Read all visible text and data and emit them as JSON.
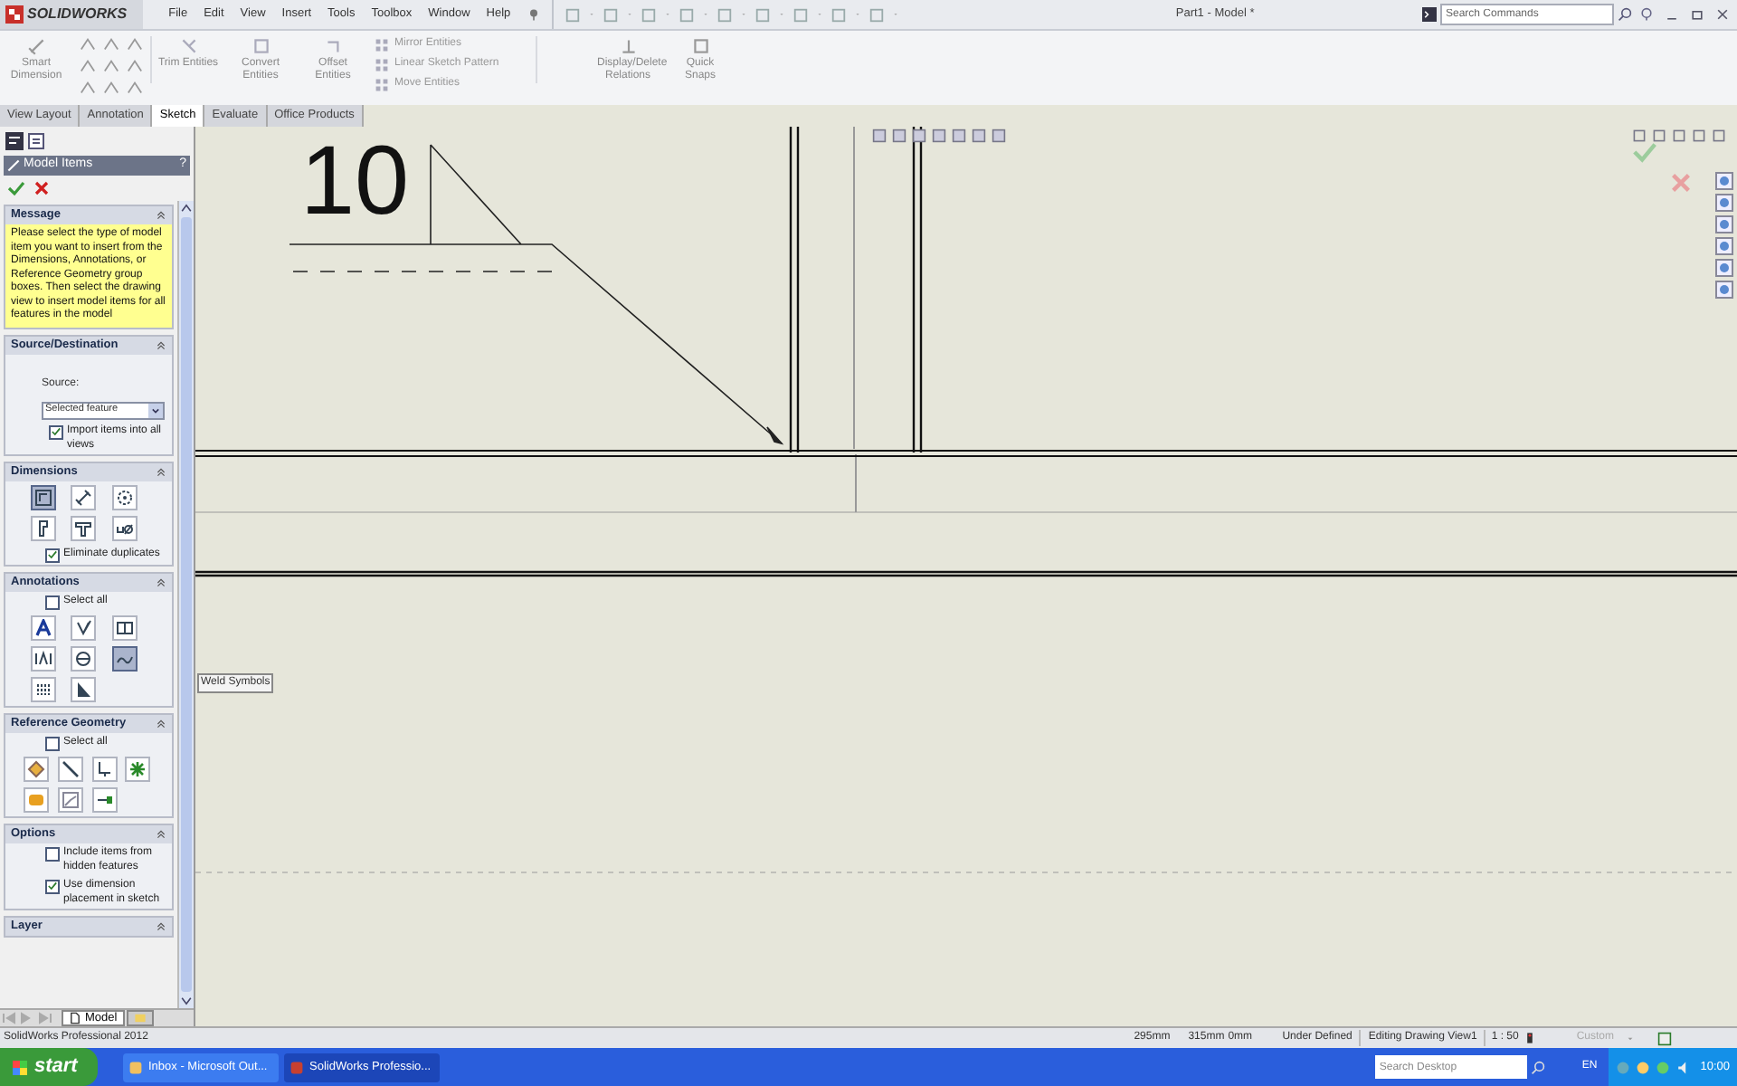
{
  "app": {
    "logo": "SOLIDWORKS",
    "menu": [
      "File",
      "Edit",
      "View",
      "Insert",
      "Tools",
      "Toolbox",
      "Window",
      "Help"
    ],
    "title": "Part1 - Model *",
    "search": {
      "placeholder": "Search Commands"
    }
  },
  "ribbon": {
    "tools": [
      {
        "label": "Smart Dimension"
      },
      {
        "label": "Trim Entities"
      },
      {
        "label": "Convert Entities"
      },
      {
        "label": "Offset Entities"
      }
    ],
    "list_tools": [
      "Mirror Entities",
      "Linear Sketch Pattern",
      "Move Entities"
    ],
    "more_tools": [
      {
        "label": "Display/Delete Relations"
      },
      {
        "label": "Quick Snaps"
      }
    ]
  },
  "tabs": [
    {
      "label": "View Layout",
      "selected": false
    },
    {
      "label": "Annotation",
      "selected": false
    },
    {
      "label": "Sketch",
      "selected": true
    },
    {
      "label": "Evaluate",
      "selected": false
    },
    {
      "label": "Office Products",
      "selected": false
    }
  ],
  "panel": {
    "title": "Model Items",
    "help": "?",
    "message": {
      "title": "Message",
      "text": "Please select the type of model item you want to insert from the Dimensions, Annotations, or Reference Geometry group boxes. Then select the drawing view to insert model items for all features in the model"
    },
    "source": {
      "title": "Source/Destination",
      "label": "Source:",
      "value": "Selected feature",
      "import_all": {
        "label": "Import items into all views",
        "checked": true
      }
    },
    "dimensions": {
      "title": "Dimensions",
      "buttons": [
        {
          "selected": true
        },
        {
          "selected": false
        },
        {
          "selected": false
        },
        {
          "selected": false
        },
        {
          "selected": false
        },
        {
          "selected": false
        }
      ],
      "eliminate": {
        "label": "Eliminate duplicates",
        "checked": true
      }
    },
    "annotations": {
      "title": "Annotations",
      "select_all": {
        "label": "Select all",
        "checked": false
      },
      "buttons": [
        {
          "selected": false
        },
        {
          "selected": false
        },
        {
          "selected": false
        },
        {
          "selected": false
        },
        {
          "selected": false
        },
        {
          "selected": true
        },
        {
          "selected": false
        },
        {
          "selected": false
        }
      ],
      "tooltip": "Weld Symbols"
    },
    "reference": {
      "title": "Reference Geometry",
      "select_all": {
        "label": "Select all",
        "checked": false
      }
    },
    "options": {
      "title": "Options",
      "items": [
        {
          "label": "Include items from hidden features",
          "checked": false
        },
        {
          "label": "Use dimension placement in sketch",
          "checked": true
        }
      ]
    },
    "layer": {
      "title": "Layer"
    }
  },
  "sheet_tabs": [
    {
      "label": "Model",
      "selected": true
    }
  ],
  "canvas": {
    "dimension_value": "10"
  },
  "status_bar": {
    "product": "SolidWorks Professional 2012",
    "x": "295mm",
    "y": "315mm",
    "z": "0mm",
    "state": "Under Defined",
    "mode": "Editing Drawing View1",
    "scale": "1 : 50",
    "units": "Custom"
  },
  "taskbar": {
    "start": "start",
    "windows": [
      {
        "label": "Inbox - Microsoft Out...",
        "selected": false
      },
      {
        "label": "SolidWorks Professio...",
        "selected": true
      }
    ],
    "search": {
      "placeholder": "Search Desktop"
    },
    "language": "EN",
    "clock": "10:00"
  }
}
